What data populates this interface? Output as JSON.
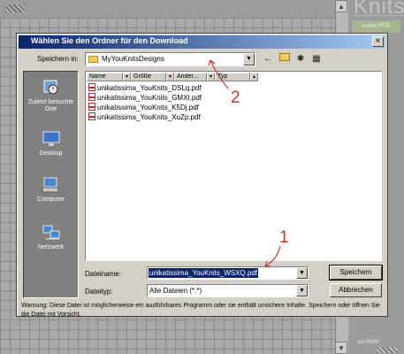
{
  "background_app": {
    "brand": "Knits",
    "make_pdf_label": "make PDF",
    "bottom_label": "set ROW"
  },
  "dialog": {
    "title": "Wählen Sie den Ordner für den Download",
    "close_glyph": "×",
    "save_in_label": "Speichern in:",
    "save_in_value": "MyYouKnitsDesigns",
    "toolbar": [
      {
        "icon": "back-arrow-icon",
        "glyph": "←"
      },
      {
        "icon": "up-folder-icon",
        "glyph": "⤴"
      },
      {
        "icon": "new-folder-icon",
        "glyph": "✱"
      },
      {
        "icon": "view-menu-icon",
        "glyph": "▦"
      }
    ],
    "places": [
      {
        "icon": "recent-places-icon",
        "label": "Zuletzt besuchte Orte"
      },
      {
        "icon": "desktop-icon",
        "label": "Desktop"
      },
      {
        "icon": "computer-icon",
        "label": "Computer"
      },
      {
        "icon": "network-icon",
        "label": "Netzwerk"
      }
    ],
    "columns": [
      "Name",
      "Größe",
      "Änder...",
      "Typ"
    ],
    "files": [
      "unikatissima_YouKnits_DSLq.pdf",
      "unikatissima_YouKnits_GMXI.pdf",
      "unikatissima_YouKnits_K5Dj.pdf",
      "unikatissima_YouKnits_XuZp.pdf"
    ],
    "filename_label": "Dateiname:",
    "filename_value": "unikatissima_YouKnits_WSXQ.pdf",
    "filetype_label": "Dateityp:",
    "filetype_value": "Alle Dateien (*.*)",
    "save_button": "Speichern",
    "cancel_button": "Abbrechen",
    "warning": "Warnung: Diese Datei ist möglicherweise ein ausführbares Programm oder sie enthält unsichere Inhalte. Speichern oder öffnen Sie die Datei mit Vorsicht."
  },
  "annotations": {
    "marker_1": "1",
    "marker_2": "2",
    "color": "#c0392b"
  }
}
